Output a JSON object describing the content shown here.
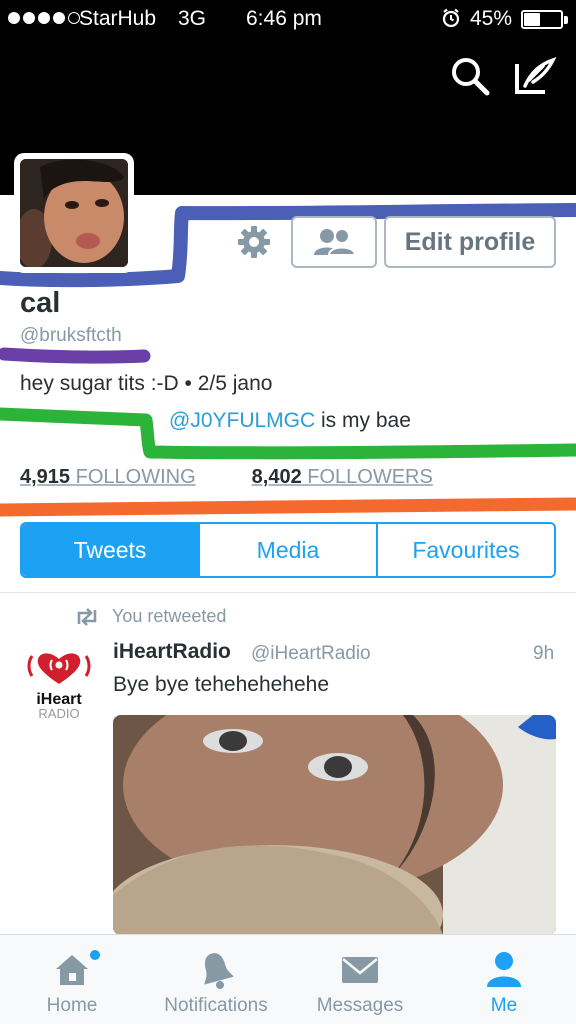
{
  "status_bar": {
    "carrier": "StarHub",
    "network": "3G",
    "time": "6:46 pm",
    "battery_percent": "45%",
    "battery_level": 0.45,
    "signal_bars": 4,
    "signal_bars_total": 5
  },
  "header": {
    "icons": [
      "search-icon",
      "compose-icon"
    ]
  },
  "profile": {
    "display_name": "cal",
    "handle": "@bruksftcth",
    "bio_line1": "hey sugar tits :-D • 2/5 jano",
    "bio_mention": "@J0YFULMGC",
    "bio_line2_rest": " is my bae",
    "edit_profile_label": "Edit profile",
    "following_count": "4,915",
    "following_label": "FOLLOWING",
    "followers_count": "8,402",
    "followers_label": "FOLLOWERS"
  },
  "segments": {
    "items": [
      "Tweets",
      "Media",
      "Favourites"
    ],
    "active": "Tweets"
  },
  "tweet": {
    "retweet_note": "You retweeted",
    "author": "iHeartRadio",
    "handle": "@iHeartRadio",
    "time": "9h",
    "text": "Bye bye tehehehehehe",
    "avatar_logo_line1": "iHeart",
    "avatar_logo_line2": "RADIO"
  },
  "tabbar": {
    "items": [
      {
        "label": "Home",
        "icon": "home-icon"
      },
      {
        "label": "Notifications",
        "icon": "bell-icon"
      },
      {
        "label": "Messages",
        "icon": "envelope-icon"
      },
      {
        "label": "Me",
        "icon": "person-icon"
      }
    ],
    "active": "Me"
  },
  "colors": {
    "accent": "#1da1f2",
    "marker_blue": "#4a5fb5",
    "marker_purple": "#6b3fa8",
    "marker_green": "#2cb43a",
    "marker_orange": "#f46a2e"
  }
}
